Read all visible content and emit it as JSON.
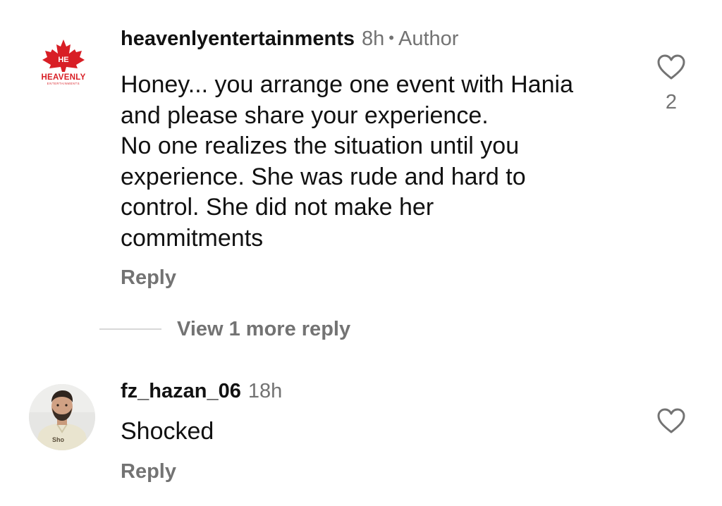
{
  "comments": [
    {
      "username": "heavenlyentertainments",
      "time": "8h",
      "separator": "•",
      "badge": "Author",
      "avatar": {
        "type": "logo",
        "icon": "maple-leaf-logo",
        "brand_text": "HEAVENLY",
        "brand_subtext": "ENTERTAINMENTS",
        "leaf_mark": "HE",
        "brand_color": "#d81e25"
      },
      "text_lines": [
        "Honey... you arrange one event with Hania",
        "and please share your experience.",
        "No one realizes the situation until you",
        "experience. She was rude and hard to",
        "control. She did not make her",
        "commitments"
      ],
      "reply_label": "Reply",
      "like_icon": "heart-outline-icon",
      "like_count": "2"
    },
    {
      "username": "fz_hazan_06",
      "time": "18h",
      "avatar": {
        "type": "photo",
        "icon": "profile-photo"
      },
      "text_lines": [
        "Shocked"
      ],
      "reply_label": "Reply",
      "like_icon": "heart-outline-icon"
    }
  ],
  "view_more_replies": "View 1 more reply",
  "colors": {
    "text_primary": "#111111",
    "text_secondary": "#737373",
    "divider": "#d8d8d8",
    "background": "#ffffff"
  }
}
